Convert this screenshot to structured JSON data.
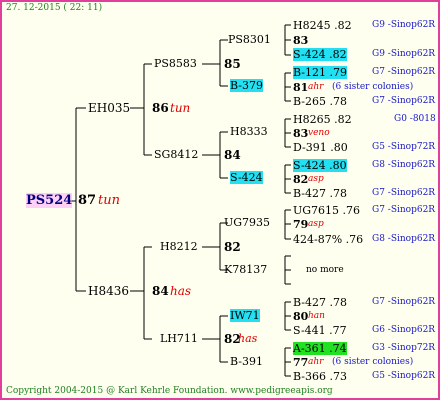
{
  "header": "27. 12-2015 ( 22: 11)",
  "footer": "Copyright 2004-2015 @ Karl Kehrle Foundation.   www.pedigreeapis.org",
  "root": {
    "name": "PS524",
    "score": "87",
    "note": "tun"
  },
  "gen1": [
    {
      "name": "EH035",
      "score": "86",
      "note": "tun"
    },
    {
      "name": "H8436",
      "score": "84",
      "note": "has"
    }
  ],
  "gen2": [
    {
      "name": "PS8583",
      "score": "85"
    },
    {
      "name": "SG8412",
      "score": "84"
    },
    {
      "name": "H8212",
      "score": "82"
    },
    {
      "name": "LH711",
      "score": "82",
      "note": "has"
    }
  ],
  "gen3": [
    {
      "name": "PS8301",
      "score": "83"
    },
    {
      "name": "B-379",
      "score": "81",
      "note": "ahr",
      "extra": "(6 sister colonies)"
    },
    {
      "name": "H8333",
      "score": "83",
      "note": "veno"
    },
    {
      "name": "S-424",
      "score": "82",
      "note": "asp"
    },
    {
      "name": "UG7935",
      "score": "79",
      "note": "asp"
    },
    {
      "name": "K78137",
      "score": "no more"
    },
    {
      "name": "IW71",
      "score": "80",
      "note": "han"
    },
    {
      "name": "B-391",
      "score": "77",
      "note": "ahr",
      "extra": "(6 sister colonies)"
    }
  ],
  "gen4": [
    {
      "name": "H8245 .82",
      "race": "G9 -Sinop62R"
    },
    {
      "name": "S-424 .82",
      "race": "G9 -Sinop62R"
    },
    {
      "name": "B-121 .79",
      "race": "G7 -Sinop62R"
    },
    {
      "name": "B-265 .78",
      "race": "G7 -Sinop62R"
    },
    {
      "name": "H8265 .82",
      "race": "G0 -8018"
    },
    {
      "name": "D-391 .80",
      "race": "G5 -Sinop72R"
    },
    {
      "name": "S-424 .80",
      "race": "G8 -Sinop62R"
    },
    {
      "name": "B-427 .78",
      "race": "G7 -Sinop62R"
    },
    {
      "name": "UG7615 .76",
      "race": "G7 -Sinop62R"
    },
    {
      "name": "424-87% .76",
      "race": "G8 -Sinop62R"
    },
    {
      "name": "B-427 .78",
      "race": "G7 -Sinop62R"
    },
    {
      "name": "S-441 .77",
      "race": "G6 -Sinop62R"
    },
    {
      "name": "A-361 .74",
      "race": "G3 -Sinop72R"
    },
    {
      "name": "B-366 .73",
      "race": "G5 -Sinop62R"
    }
  ]
}
